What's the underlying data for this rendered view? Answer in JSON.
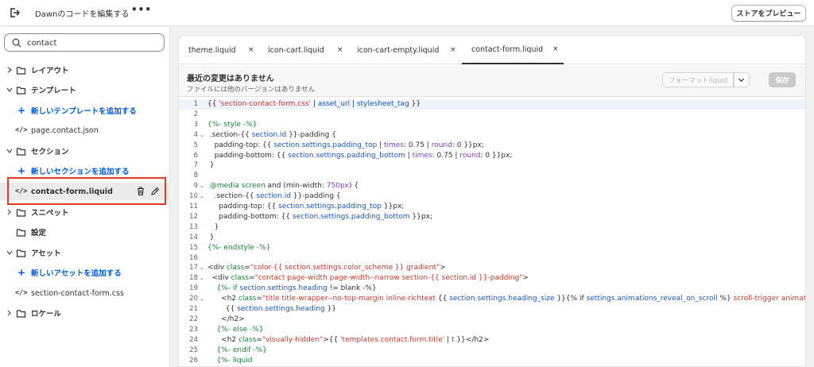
{
  "topbar": {
    "title": "Dawnのコードを編集する",
    "more": "•••",
    "preview_label": "ストアをプレビュー"
  },
  "search": {
    "value": "contact",
    "placeholder": ""
  },
  "sidebar": {
    "items": [
      {
        "label": "レイアウト",
        "type": "folder"
      },
      {
        "label": "テンプレート",
        "type": "folder"
      },
      {
        "label": "新しいテンプレートを追加する",
        "type": "add"
      },
      {
        "label": "page.contact.json",
        "type": "file"
      },
      {
        "label": "セクション",
        "type": "folder"
      },
      {
        "label": "新しいセクションを追加する",
        "type": "add"
      },
      {
        "label": "contact-form.liquid",
        "type": "file",
        "selected": true
      },
      {
        "label": "スニペット",
        "type": "folder"
      },
      {
        "label": "設定",
        "type": "folder-nochev"
      },
      {
        "label": "アセット",
        "type": "folder"
      },
      {
        "label": "新しいアセットを追加する",
        "type": "add"
      },
      {
        "label": "section-contact-form.css",
        "type": "file"
      },
      {
        "label": "ロケール",
        "type": "folder"
      }
    ]
  },
  "tabs": [
    {
      "label": "theme.liquid",
      "close": "×"
    },
    {
      "label": "icon-cart.liquid",
      "close": "×"
    },
    {
      "label": "icon-cart-empty.liquid",
      "close": "×"
    },
    {
      "label": "contact-form.liquid",
      "close": "×",
      "active": true
    }
  ],
  "infobar": {
    "heading": "最近の変更はありません",
    "subheading": "ファイルには他のバージョンはありません",
    "format_label": "フォーマットliquid",
    "save_label": "保存"
  },
  "code_lines": [
    {
      "n": "1",
      "fold": "",
      "html": "{{ <s>'section-contact-form.css'</s> | <v>asset_url</v> | <v>stylesheet_tag</v> }}"
    },
    {
      "n": "2",
      "fold": "",
      "html": ""
    },
    {
      "n": "3",
      "fold": "",
      "html": "<k>{%- style -%}</k>"
    },
    {
      "n": "4",
      "fold": "⌄",
      "html": " .section-{{ <v>section.id</v> }}-padding {"
    },
    {
      "n": "5",
      "fold": "",
      "html": "   padding-top: {{ <v>section.settings.padding_top</v> | <f>times</f>: 0.75 | <f>round</f>: 0 }}px;"
    },
    {
      "n": "6",
      "fold": "",
      "html": "   padding-bottom: {{ <v>section.settings.padding_bottom</v> | <f>times</f>: 0.75 | <f>round</f>: 0 }}px;"
    },
    {
      "n": "7",
      "fold": "",
      "html": " }"
    },
    {
      "n": "8",
      "fold": "",
      "html": ""
    },
    {
      "n": "9",
      "fold": "⌄",
      "html": " <k>@media screen</k> and (min-width: <f>750px</f>) {"
    },
    {
      "n": "10",
      "fold": "⌄",
      "html": "   .section-{{ <v>section.id</v> }}-padding {"
    },
    {
      "n": "11",
      "fold": "",
      "html": "     padding-top: {{ <v>section.settings.padding_top</v> }}px;"
    },
    {
      "n": "12",
      "fold": "",
      "html": "     padding-bottom: {{ <v>section.settings.padding_bottom</v> }}px;"
    },
    {
      "n": "13",
      "fold": "",
      "html": "   }"
    },
    {
      "n": "14",
      "fold": "",
      "html": " }"
    },
    {
      "n": "15",
      "fold": "",
      "html": "<k>{%- endstyle -%}</k>"
    },
    {
      "n": "16",
      "fold": "",
      "html": ""
    },
    {
      "n": "17",
      "fold": "⌄",
      "html": "<div <k>class</k>=<s>\"color-{{ section.settings.color_scheme }} gradient\"</s>>"
    },
    {
      "n": "18",
      "fold": "⌄",
      "html": "  <div <k>class</k>=<s>\"contact page-width page-width--narrow section-{{ section.id }}-padding\"</s>>"
    },
    {
      "n": "19",
      "fold": "",
      "html": "    <k>{%- if</k> <v>section.settings.heading</v> != blank -%}"
    },
    {
      "n": "20",
      "fold": "⌄",
      "html": "      <h2 <k>class</k>=<s>\"title title-wrapper--no-top-margin inline-richtext</s> {{ <v>section.settings.heading_size</v> }}{% if <v>settings.animations_reveal_on_scroll</v> %} <s>scroll-trigger animate--s</s>"
    },
    {
      "n": "21",
      "fold": "",
      "html": "        {{ <v>section.settings.heading</v> }}"
    },
    {
      "n": "22",
      "fold": "",
      "html": "      </h2>"
    },
    {
      "n": "23",
      "fold": "",
      "html": "    <k>{%- else -%}</k>"
    },
    {
      "n": "24",
      "fold": "",
      "html": "      <h2 <k>class</k>=<s>\"visually-hidden\"</s>>{{ <s>'templates.contact.form.title'</s> | <f>t</f> }}</h2>"
    },
    {
      "n": "25",
      "fold": "",
      "html": "    <k>{%- endif -%}</k>"
    },
    {
      "n": "26",
      "fold": "",
      "html": "    <k>{%- liquid</k>"
    }
  ],
  "colors": {
    "accent_blue": "#005bd3",
    "highlight_red": "#e5391f",
    "liquid_green": "#1a7f37",
    "string_red": "#c0392b",
    "variable_blue": "#1e55b3",
    "filter_purple": "#7a3fb8"
  }
}
